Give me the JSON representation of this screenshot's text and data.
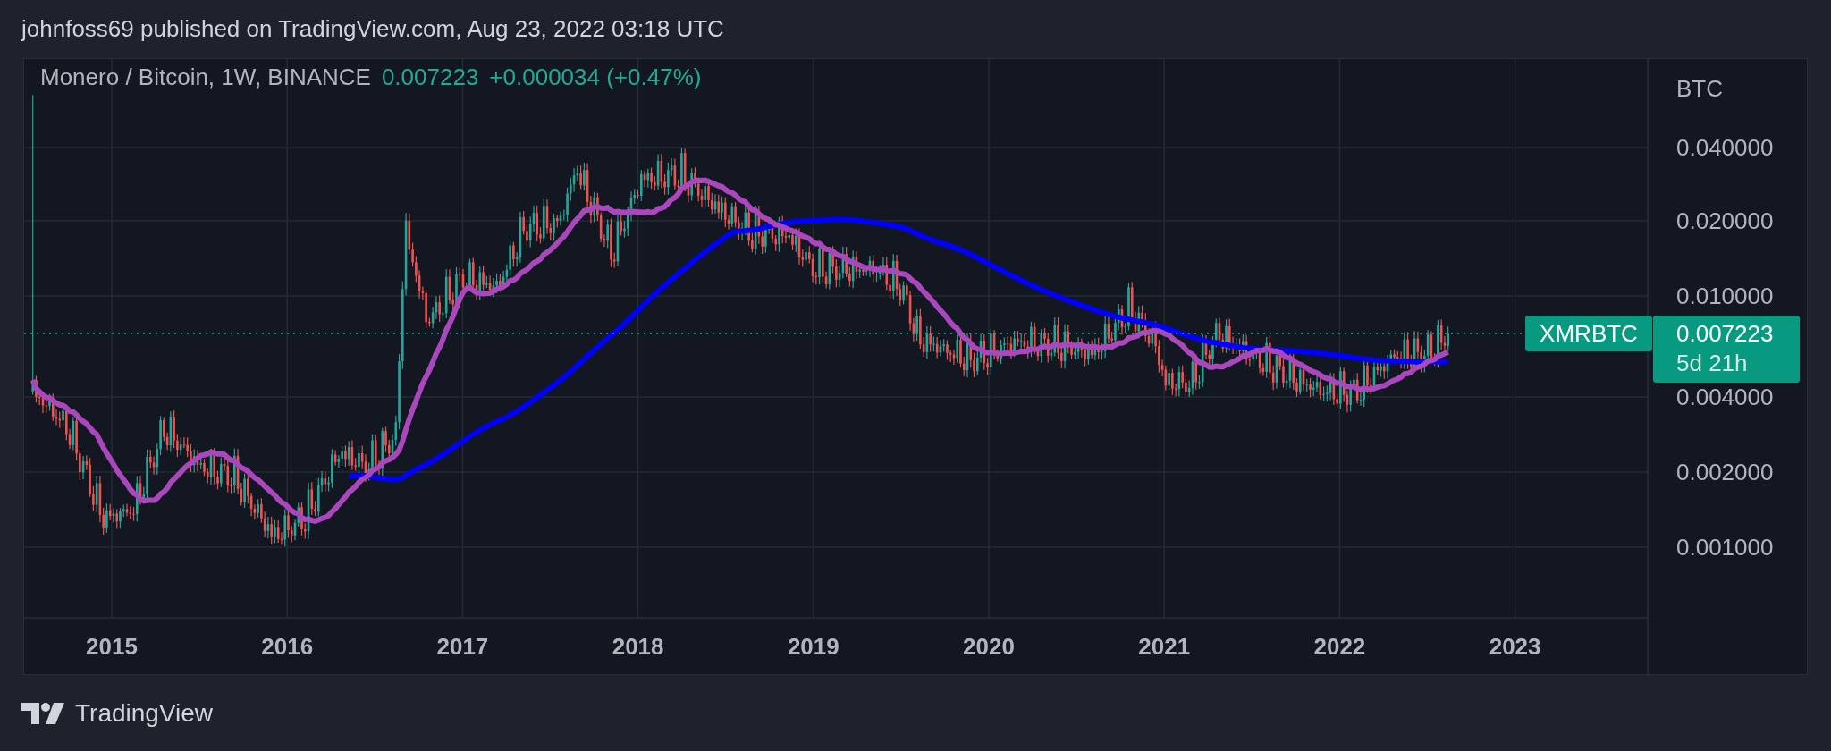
{
  "header": {
    "text": "johnfoss69 published on TradingView.com, Aug 23, 2022 03:18 UTC"
  },
  "legend": {
    "symbol": "Monero / Bitcoin, 1W, BINANCE",
    "price": "0.007223",
    "change": "+0.000034 (+0.47%)"
  },
  "price_axis": {
    "unit": "BTC",
    "labels": [
      "0.040000",
      "0.020000",
      "0.010000",
      "0.004000",
      "0.002000",
      "0.001000"
    ]
  },
  "time_axis": {
    "labels": [
      "2015",
      "2016",
      "2017",
      "2018",
      "2019",
      "2020",
      "2021",
      "2022",
      "2023"
    ]
  },
  "price_label": {
    "symbol": "XMRBTC",
    "price": "0.007223",
    "countdown": "5d 21h"
  },
  "footer": {
    "brand": "TradingView"
  }
}
